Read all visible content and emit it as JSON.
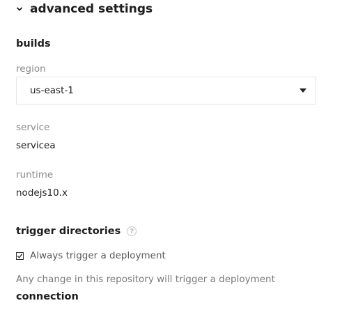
{
  "advanced": {
    "title": "advanced settings"
  },
  "builds": {
    "title": "builds",
    "region_label": "region",
    "region_value": "us-east-1",
    "service_label": "service",
    "service_value": "servicea",
    "runtime_label": "runtime",
    "runtime_value": "nodejs10.x"
  },
  "trigger": {
    "title": "trigger directories",
    "help_glyph": "?",
    "checkbox_label": "Always trigger a deployment",
    "checkbox_checked": true,
    "description": "Any change in this repository will trigger a deployment"
  },
  "connection": {
    "title": "connection"
  }
}
